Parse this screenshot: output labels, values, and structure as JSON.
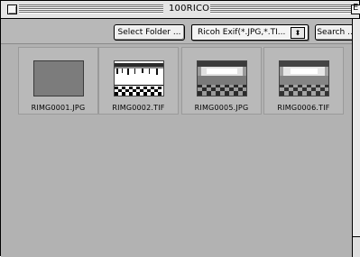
{
  "window": {
    "title": "100RICOH"
  },
  "toolbar": {
    "select_folder_label": "Select Folder ...",
    "filter_value": "Ricoh Exif(*.JPG,*.TI...",
    "filter_arrows": "⬍",
    "search_label": "Search ..."
  },
  "files": [
    {
      "name": "RIMG0001.JPG",
      "thumb": "blank-gray"
    },
    {
      "name": "RIMG0002.TIF",
      "thumb": "checker-scene"
    },
    {
      "name": "RIMG0005.JPG",
      "thumb": "hall-scene"
    },
    {
      "name": "RIMG0006.TIF",
      "thumb": "hall-scene"
    }
  ],
  "colors": {
    "window_bg": "#b2b2b2",
    "titlebar": "#e4e4e4"
  }
}
